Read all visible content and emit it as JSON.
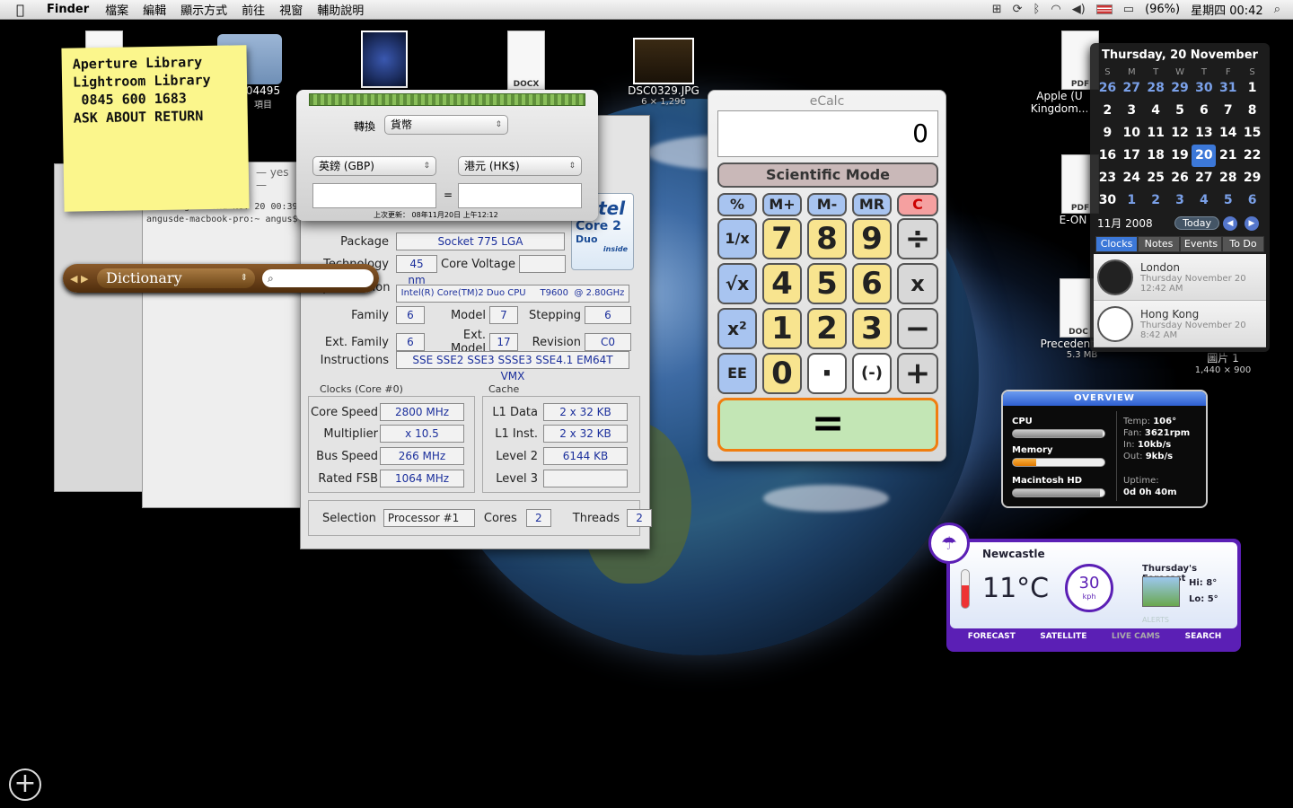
{
  "menubar": {
    "app": "Finder",
    "menus": [
      "檔案",
      "編輯",
      "顯示方式",
      "前往",
      "視窗",
      "輔助說明"
    ],
    "battery": "(96%)",
    "clock": "星期四 00:42"
  },
  "desktop": {
    "icons": [
      {
        "label": "",
        "kind": "doc"
      },
      {
        "label": "04495",
        "sub": "項目",
        "kind": "folder"
      },
      {
        "label": "",
        "kind": "thumb"
      },
      {
        "label": "",
        "kind": "docx",
        "badge": "DOCX"
      },
      {
        "label": "DSC0329.JPG",
        "sub": "6 × 1,296",
        "kind": "photo"
      },
      {
        "label": "Apple (U Kingdom...",
        "kind": "pdf",
        "badge": "PDF"
      },
      {
        "label": "E-ON",
        "kind": "pdf",
        "badge": "PDF"
      },
      {
        "label": "Precedent.docx",
        "sub": "5.3 MB",
        "kind": "docx",
        "badge": "DOC"
      },
      {
        "label": "圖片 1",
        "sub": "1,440 × 900",
        "kind": "image"
      }
    ]
  },
  "sticky": {
    "lines": [
      "Aperture Library",
      "Lightroom Library",
      " 0845 600 1683",
      "ASK ABOUT RETURN"
    ]
  },
  "terminal": {
    "title": "— yes —",
    "line1": "Last login: Thu Nov 20 00:39",
    "prompt": "angusde-macbook-pro:~ angus$"
  },
  "dictionary": {
    "label": "Dictionary",
    "search_placeholder": ""
  },
  "cpuz": {
    "package_label": "Package",
    "package": "Socket 775 LGA",
    "technology_label": "Technology",
    "technology": "45 nm",
    "core_voltage_label": "Core Voltage",
    "core_voltage": "",
    "spec_label": "Specification",
    "spec": "Intel(R) Core(TM)2 Duo CPU     T9600  @ 2.80GHz",
    "family_label": "Family",
    "family": "6",
    "model_label": "Model",
    "model": "7",
    "stepping_label": "Stepping",
    "stepping": "6",
    "ext_family_label": "Ext. Family",
    "ext_family": "6",
    "ext_model_label": "Ext. Model",
    "ext_model": "17",
    "revision_label": "Revision",
    "revision": "C0",
    "instructions_label": "Instructions",
    "instructions": "SSE SSE2 SSE3 SSSE3 SSE4.1 EM64T VMX",
    "clocks_title": "Clocks (Core #0)",
    "core_speed_label": "Core Speed",
    "core_speed": "2800 MHz",
    "multiplier_label": "Multiplier",
    "multiplier": "x 10.5",
    "bus_speed_label": "Bus Speed",
    "bus_speed": "266 MHz",
    "rated_fsb_label": "Rated FSB",
    "rated_fsb": "1064 MHz",
    "cache_title": "Cache",
    "l1d_label": "L1 Data",
    "l1d": "2 x 32 KB",
    "l1i_label": "L1 Inst.",
    "l1i": "2 x 32 KB",
    "l2_label": "Level 2",
    "l2": "6144 KB",
    "l3_label": "Level 3",
    "l3": "",
    "selection_label": "Selection",
    "selection": "Processor #1",
    "cores_label": "Cores",
    "cores": "2",
    "threads_label": "Threads",
    "threads": "2",
    "logo_brand": "intel",
    "logo_line1": "Core 2",
    "logo_line2": "Duo",
    "logo_inside": "inside"
  },
  "converter": {
    "convert_label": "轉換",
    "category": "貨幣",
    "from": "英鎊 (GBP)",
    "to": "港元 (HK$)",
    "equals": "=",
    "from_value": "",
    "to_value": "",
    "updated": "上次更新： 08年11月20日 上午12:12"
  },
  "ecalc": {
    "title": "eCalc",
    "display": "0",
    "mode": "Scientific Mode",
    "keys_top": [
      "%",
      "M+",
      "M-",
      "MR",
      "C"
    ],
    "row1": [
      "1/x",
      "7",
      "8",
      "9",
      "÷"
    ],
    "row2": [
      "√x",
      "4",
      "5",
      "6",
      "x"
    ],
    "row3": [
      "x²",
      "1",
      "2",
      "3",
      "−"
    ],
    "row4": [
      "EE",
      "0",
      "·",
      "(-)",
      "+"
    ],
    "equals": "="
  },
  "calendar": {
    "header": "Thursday, 20 November",
    "dow": [
      "S",
      "M",
      "T",
      "W",
      "T",
      "F",
      "S"
    ],
    "weeks": [
      [
        "26",
        "27",
        "28",
        "29",
        "30",
        "31",
        "1"
      ],
      [
        "2",
        "3",
        "4",
        "5",
        "6",
        "7",
        "8"
      ],
      [
        "9",
        "10",
        "11",
        "12",
        "13",
        "14",
        "15"
      ],
      [
        "16",
        "17",
        "18",
        "19",
        "20",
        "21",
        "22"
      ],
      [
        "23",
        "24",
        "25",
        "26",
        "27",
        "28",
        "29"
      ],
      [
        "30",
        "1",
        "2",
        "3",
        "4",
        "5",
        "6"
      ]
    ],
    "month_label": "11月 2008",
    "today_label": "Today",
    "tabs": [
      "Clocks",
      "Notes",
      "Events",
      "To Do"
    ],
    "clocks": [
      {
        "city": "London",
        "date": "Thursday November 20",
        "time": "12:42 AM"
      },
      {
        "city": "Hong Kong",
        "date": "Thursday November 20",
        "time": "8:42 AM"
      }
    ]
  },
  "overview": {
    "title": "OVERVIEW",
    "cpu_label": "CPU",
    "cpu_level": 0.98,
    "memory_label": "Memory",
    "memory_level": 0.25,
    "disk_label": "Macintosh HD",
    "disk_level": 0.95,
    "temp_label": "Temp:",
    "temp": "106°",
    "fan_label": "Fan:",
    "fan": "3621rpm",
    "in_label": "In:",
    "in": "10kb/s",
    "out_label": "Out:",
    "out": "9kb/s",
    "uptime_label": "Uptime:",
    "uptime": "0d 0h 40m"
  },
  "weather": {
    "city": "Newcastle",
    "temp": "11°C",
    "wind": "30",
    "wind_unit": "kph",
    "forecast_title": "Thursday's Forecast",
    "hi": "Hi: 8°",
    "lo": "Lo: 5°",
    "alerts": "ALERTS",
    "links": [
      "FORECAST",
      "SATELLITE",
      "LIVE CAMS",
      "SEARCH"
    ]
  }
}
